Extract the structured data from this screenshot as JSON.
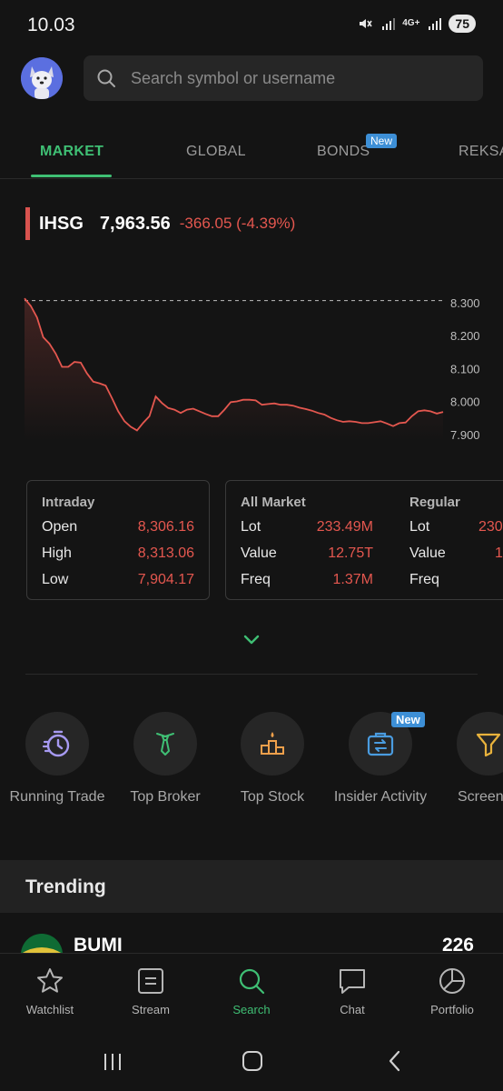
{
  "status": {
    "time": "10.03",
    "network": "4G+",
    "battery": "75"
  },
  "search": {
    "placeholder": "Search symbol or username"
  },
  "tabs": [
    {
      "label": "MARKET",
      "active": true
    },
    {
      "label": "GLOBAL"
    },
    {
      "label": "BONDS",
      "badge": "New"
    },
    {
      "label": "REKSA"
    }
  ],
  "index": {
    "name": "IHSG",
    "value": "7,963.56",
    "change": "-366.05 (-4.39%)"
  },
  "chart_data": {
    "type": "line",
    "y_ticks": [
      "8.300",
      "8.200",
      "8.100",
      "8.000",
      "7.900"
    ],
    "ylim": [
      7880,
      8330
    ],
    "reference_line": 8306.16,
    "values": [
      8313,
      8290,
      8255,
      8195,
      8175,
      8145,
      8105,
      8105,
      8120,
      8118,
      8085,
      8060,
      8055,
      8048,
      8010,
      7970,
      7940,
      7923,
      7912,
      7935,
      7955,
      8015,
      7995,
      7980,
      7975,
      7965,
      7975,
      7978,
      7970,
      7962,
      7955,
      7955,
      7975,
      7998,
      8000,
      8005,
      8005,
      8003,
      7990,
      7992,
      7994,
      7990,
      7990,
      7987,
      7981,
      7977,
      7972,
      7965,
      7960,
      7950,
      7943,
      7938,
      7940,
      7938,
      7934,
      7934,
      7937,
      7940,
      7933,
      7925,
      7934,
      7936,
      7955,
      7970,
      7973,
      7970,
      7963,
      7968
    ],
    "line_color": "#e4574f"
  },
  "intraday": {
    "title": "Intraday",
    "rows": [
      {
        "label": "Open",
        "value": "8,306.16"
      },
      {
        "label": "High",
        "value": "8,313.06"
      },
      {
        "label": "Low",
        "value": "7,904.17"
      }
    ]
  },
  "all_market": {
    "title": "All Market",
    "rows": [
      {
        "label": "Lot",
        "value": "233.49M"
      },
      {
        "label": "Value",
        "value": "12.75T"
      },
      {
        "label": "Freq",
        "value": "1.37M"
      }
    ]
  },
  "regular": {
    "title": "Regular",
    "rows": [
      {
        "label": "Lot",
        "value": "230"
      },
      {
        "label": "Value",
        "value": "1"
      },
      {
        "label": "Freq",
        "value": ""
      }
    ]
  },
  "features": [
    {
      "label": "Running Trade",
      "icon": "stopwatch-icon"
    },
    {
      "label": "Top Broker",
      "icon": "necktie-icon"
    },
    {
      "label": "Top Stock",
      "icon": "podium-icon"
    },
    {
      "label": "Insider Activity",
      "icon": "briefcase-transfer-icon",
      "badge": "New"
    },
    {
      "label": "Screen",
      "icon": "filter-icon"
    }
  ],
  "trending": {
    "title": "Trending",
    "items": [
      {
        "symbol": "BUMI",
        "price": "226"
      }
    ]
  },
  "nav": [
    {
      "label": "Watchlist",
      "icon": "star-icon"
    },
    {
      "label": "Stream",
      "icon": "stream-icon"
    },
    {
      "label": "Search",
      "icon": "search-icon",
      "active": true
    },
    {
      "label": "Chat",
      "icon": "chat-icon"
    },
    {
      "label": "Portfolio",
      "icon": "pie-chart-icon"
    }
  ],
  "colors": {
    "accent": "#3fbf74",
    "negative": "#e4574f",
    "badge": "#3d8fd6",
    "background": "#141414"
  }
}
